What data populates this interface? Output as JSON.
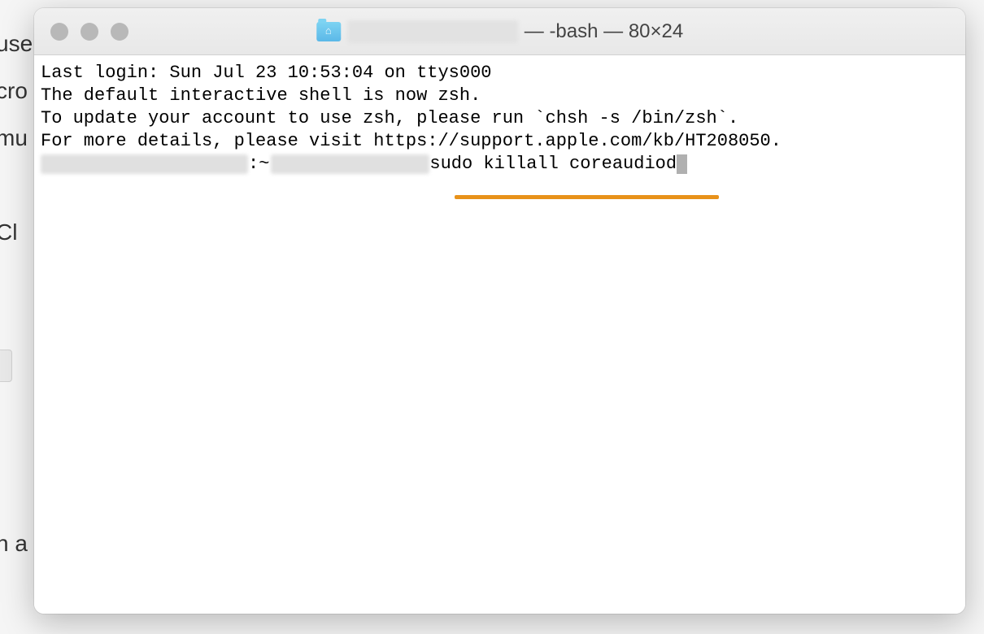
{
  "background": {
    "line1": "use",
    "line2": "cro",
    "line3": "mu",
    "line4": "Cl",
    "line5": "n a"
  },
  "window": {
    "title_suffix": "— -bash — 80×24"
  },
  "terminal": {
    "line1": "Last login: Sun Jul 23 10:53:04 on ttys000",
    "line2": "",
    "line3": "The default interactive shell is now zsh.",
    "line4": "To update your account to use zsh, please run `chsh -s /bin/zsh`.",
    "line5": "For more details, please visit https://support.apple.com/kb/HT208050.",
    "prompt_middle": ":~ ",
    "command": " sudo killall coreaudiod"
  },
  "annotation": {
    "underline_color": "#e8921a"
  }
}
